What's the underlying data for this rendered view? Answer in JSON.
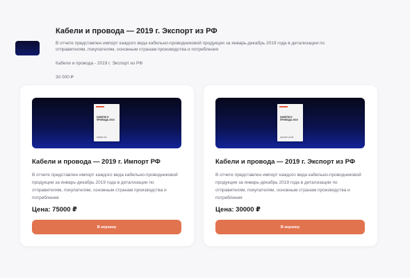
{
  "summary": {
    "title": "Кабели и провода — 2019 г. Экспорт из РФ",
    "description": "В отчете представлен импорт каждого вида кабельно-проводниковой продукции за январь-декабрь 2019 года в детализации по отправителям, покупателям, основным странам производства и потребления",
    "subtitle": "Кабели и провода - 2019 г. Экспорт из РФ",
    "price": "30 000 ₽"
  },
  "products": [
    {
      "title": "Кабели и провода — 2019 г. Импорт РФ",
      "description": "В отчете представлен импорт каждого вида кабельно-проводниковой продукции за январь-декабрь 2019 года в детализации по отправителям, покупателям, основным странам производства и потребления",
      "price": "Цена: 75000 ₽",
      "button_label": "В корзину",
      "cover_title": "Кабели и провода 2019",
      "cover_footer": "Импорт РФ"
    },
    {
      "title": "Кабели и провода — 2019 г. Экспорт из РФ",
      "description": "В отчете представлен импорт каждого вида кабельно-проводниковой продукции за январь-декабрь 2019 года в детализации по отправителям, покупателям, основным странам производства и потребления",
      "price": "Цена: 30000 ₽",
      "button_label": "В корзину",
      "cover_title": "Кабели и провода 2019",
      "cover_footer": "Экспорт из РФ"
    }
  ],
  "colors": {
    "accent": "#e2734f",
    "cover_dark": "#07091c",
    "cover_blue": "#122399"
  }
}
